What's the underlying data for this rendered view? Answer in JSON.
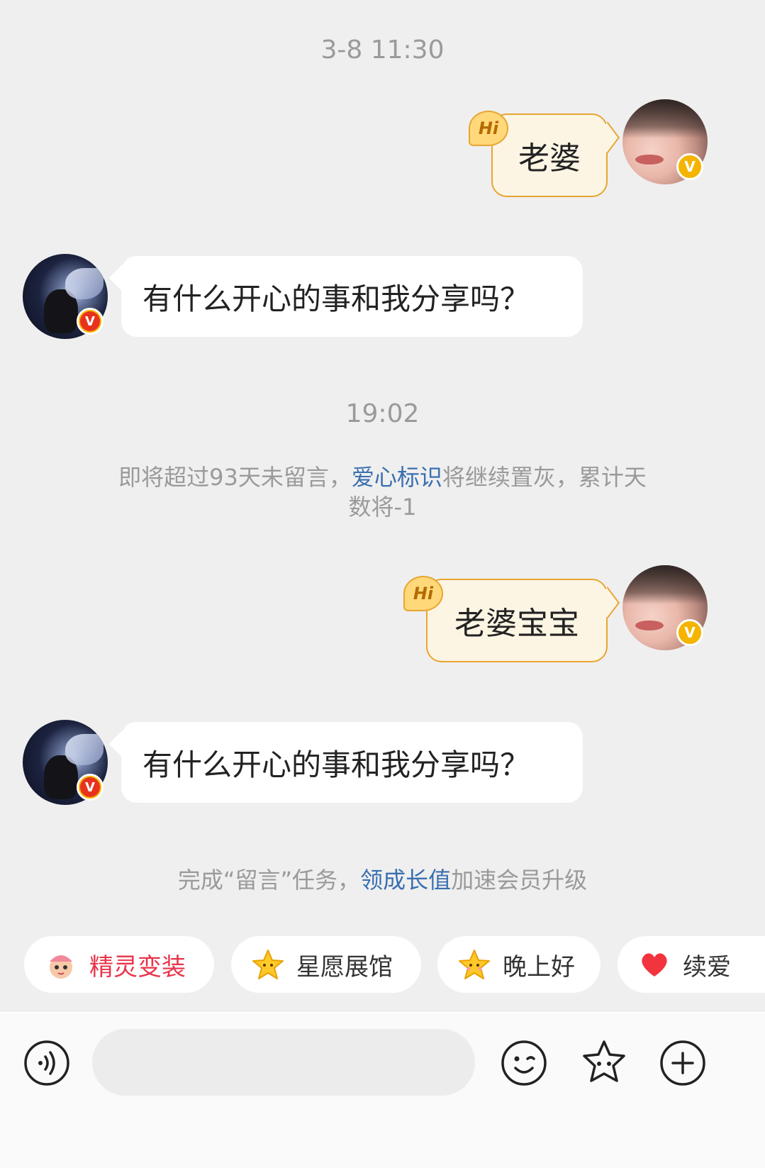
{
  "messages": {
    "time1": "3-8 11:30",
    "self_msg1": "老婆",
    "other_msg1": "有什么开心的事和我分享吗？",
    "time2": "19:02",
    "notice": {
      "part1": "即将超过93天未留言，",
      "link": "爱心标识",
      "part2": "将继续置灰，累计天",
      "line2": "数将-1"
    },
    "self_msg2": "老婆宝宝",
    "other_msg2": "有什么开心的事和我分享吗？",
    "task": {
      "part1": "完成“留言”任务，",
      "link": "领成长值",
      "part2": "加速会员升级"
    }
  },
  "badges": {
    "hi": "Hi",
    "v": "V"
  },
  "quick_actions": [
    {
      "label": "精灵变装",
      "icon": "sprite-costume-icon"
    },
    {
      "label": "星愿展馆",
      "icon": "star-icon"
    },
    {
      "label": "晚上好",
      "icon": "star-icon"
    },
    {
      "label": "续爱",
      "icon": "heart-icon"
    }
  ],
  "input": {
    "placeholder": ""
  },
  "colors": {
    "background": "#efefef",
    "self_bubble": "#fdf5e4",
    "self_bubble_border": "#e8a531",
    "link": "#3a6fb0",
    "vip_gold": "#f4b400",
    "red_chip": "#e8344a"
  }
}
